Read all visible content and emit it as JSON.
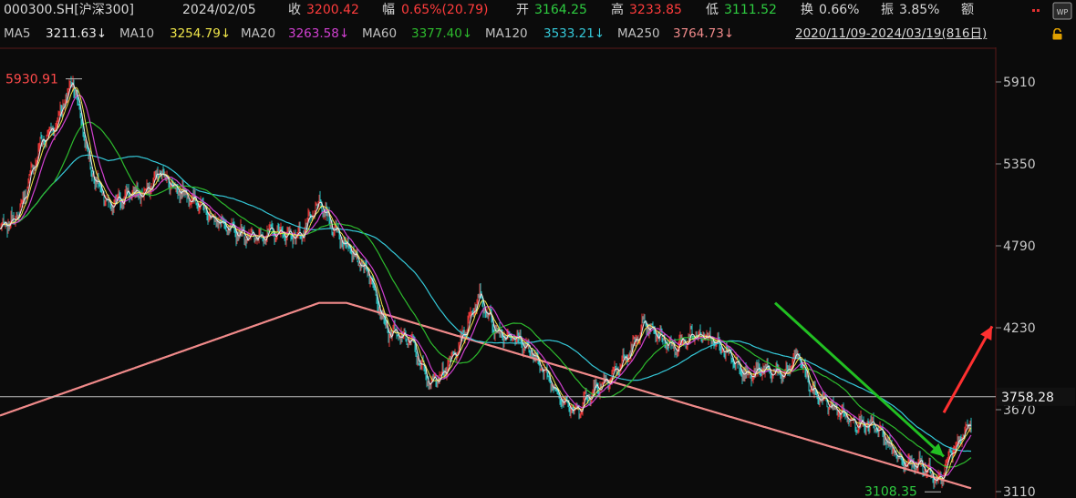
{
  "header": {
    "code": "000300.SH[沪深300]",
    "date": "2024/02/05",
    "close_label": "收",
    "close": "3200.42",
    "change_label": "幅",
    "change": "0.65%(20.79)",
    "open_label": "开",
    "open": "3164.25",
    "high_label": "高",
    "high": "3233.85",
    "low_label": "低",
    "low": "3111.52",
    "turnover_label": "换",
    "turnover": "0.66%",
    "amplitude_label": "振",
    "amplitude": "3.85%",
    "amount_label": "额",
    "more_icon": "ellipsis-icon",
    "wp_badge": "WP"
  },
  "ma_bar": {
    "items": [
      {
        "label": "MA5",
        "value": "3211.63↓",
        "color": "#e8e8e8"
      },
      {
        "label": "MA10",
        "value": "3254.79↓",
        "color": "#f0e64a"
      },
      {
        "label": "MA20",
        "value": "3263.58↓",
        "color": "#d040d0"
      },
      {
        "label": "MA60",
        "value": "3377.40↓",
        "color": "#2dbb2d"
      },
      {
        "label": "MA120",
        "value": "3533.21↓",
        "color": "#35c9d9"
      },
      {
        "label": "MA250",
        "value": "3764.73↓",
        "color": "#f08a8a"
      }
    ],
    "range": "2020/11/09-2024/03/19(816日)",
    "lock_icon": "lock-icon"
  },
  "chart_data": {
    "type": "candlestick",
    "y_ticks": [
      5910,
      5350,
      4790,
      4230,
      3670,
      3110
    ],
    "ylim": [
      3050,
      6060
    ],
    "current_line": 3758.28,
    "current_label": "3758.28",
    "max_label": "5930.91",
    "min_label": "3108.35",
    "colors": {
      "up": "#ff3c3c",
      "down": "#2dd4d4",
      "ma5": "#e8e8e8",
      "ma10": "#f0e64a",
      "ma20": "#d040d0",
      "ma60": "#2dbb2d",
      "ma120": "#35c9d9",
      "ma250": "#f08a8a"
    },
    "keypoints": [
      [
        0,
        4900
      ],
      [
        20,
        5000
      ],
      [
        45,
        5500
      ],
      [
        60,
        5600
      ],
      [
        80,
        5930
      ],
      [
        100,
        5300
      ],
      [
        120,
        5050
      ],
      [
        140,
        5150
      ],
      [
        160,
        5150
      ],
      [
        175,
        5300
      ],
      [
        190,
        5200
      ],
      [
        215,
        5100
      ],
      [
        230,
        5000
      ],
      [
        250,
        4900
      ],
      [
        280,
        4850
      ],
      [
        300,
        4880
      ],
      [
        330,
        4860
      ],
      [
        350,
        5080
      ],
      [
        365,
        4920
      ],
      [
        385,
        4750
      ],
      [
        405,
        4600
      ],
      [
        425,
        4200
      ],
      [
        450,
        4150
      ],
      [
        470,
        3850
      ],
      [
        490,
        3950
      ],
      [
        510,
        4200
      ],
      [
        525,
        4450
      ],
      [
        545,
        4200
      ],
      [
        570,
        4150
      ],
      [
        590,
        4000
      ],
      [
        610,
        3800
      ],
      [
        630,
        3650
      ],
      [
        650,
        3800
      ],
      [
        670,
        3900
      ],
      [
        690,
        4050
      ],
      [
        705,
        4250
      ],
      [
        720,
        4180
      ],
      [
        740,
        4100
      ],
      [
        760,
        4180
      ],
      [
        780,
        4150
      ],
      [
        800,
        4050
      ],
      [
        820,
        3900
      ],
      [
        840,
        3950
      ],
      [
        860,
        3900
      ],
      [
        875,
        4050
      ],
      [
        890,
        3800
      ],
      [
        910,
        3700
      ],
      [
        935,
        3600
      ],
      [
        960,
        3550
      ],
      [
        990,
        3300
      ],
      [
        1010,
        3300
      ],
      [
        1030,
        3180
      ],
      [
        1045,
        3400
      ],
      [
        1065,
        3580
      ]
    ],
    "arrows": [
      {
        "color": "#22c022",
        "from": [
          850,
          4400
        ],
        "to": [
          1035,
          3350
        ]
      },
      {
        "color": "#ff3030",
        "from": [
          1035,
          3650
        ],
        "to": [
          1088,
          4240
        ]
      }
    ]
  }
}
